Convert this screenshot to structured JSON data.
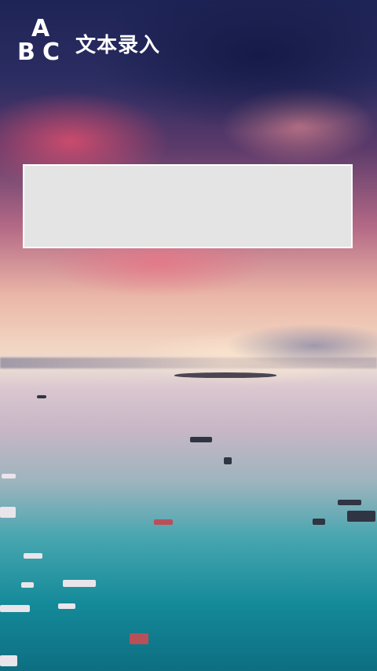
{
  "header": {
    "logo_letters": {
      "a": "A",
      "b": "B",
      "c": "C"
    },
    "title": "文本录入"
  },
  "text_input": {
    "value": "",
    "placeholder": ""
  },
  "colors": {
    "input_background": "#e4e4e4",
    "input_border": "#ffffff",
    "header_text": "#ffffff"
  }
}
